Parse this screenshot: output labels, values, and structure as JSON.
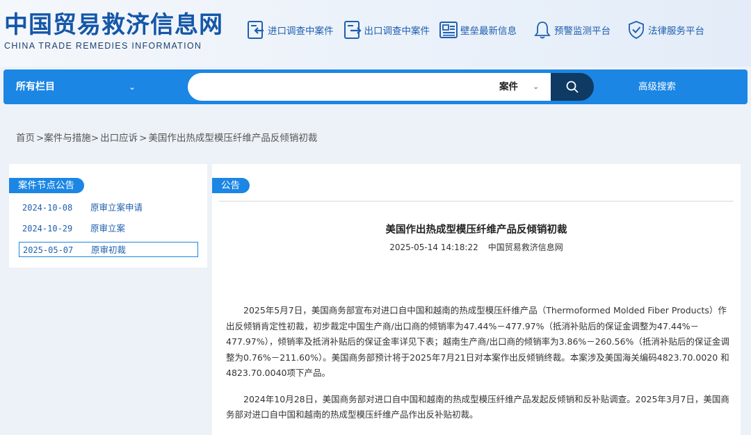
{
  "site": {
    "logo_cn": "中国贸易救济信息网",
    "logo_en": "CHINA TRADE REMEDIES INFORMATION"
  },
  "topnav": [
    {
      "label": "进口调查中案件",
      "icon": "import-case-icon"
    },
    {
      "label": "出口调查中案件",
      "icon": "export-case-icon"
    },
    {
      "label": "壁垒最新信息",
      "icon": "barrier-news-icon"
    },
    {
      "label": "预警监测平台",
      "icon": "bell-icon"
    },
    {
      "label": "法律服务平台",
      "icon": "shield-check-icon"
    }
  ],
  "searchbar": {
    "all_columns": "所有栏目",
    "query": "",
    "type": "案件",
    "advanced": "高级搜索"
  },
  "breadcrumb": [
    "首页",
    ">案件与措施>",
    "出口应诉",
    ">",
    "美国作出热成型模压纤维产品反倾销初裁"
  ],
  "left_panel": {
    "title": "案件节点公告",
    "nodes": [
      {
        "date": "2024-10-08",
        "name": "原审立案申请"
      },
      {
        "date": "2024-10-29",
        "name": "原审立案"
      },
      {
        "date": "2025-05-07",
        "name": "原审初裁"
      }
    ],
    "selected_index": 2
  },
  "main": {
    "tag": "公告",
    "title": "美国作出热成型模压纤维产品反倾销初裁",
    "datetime": "2025-05-14 14:18:22",
    "source": "中国贸易救济信息网",
    "paragraphs": [
      "2025年5月7日，美国商务部宣布对进口自中国和越南的热成型模压纤维产品（Thermoformed Molded Fiber Products）作出反倾销肯定性初裁，初步裁定中国生产商/出口商的倾销率为47.44%－477.97%（抵消补贴后的保证金调整为47.44%－477.97%），倾销率及抵消补贴后的保证金率详见下表；越南生产商/出口商的倾销率为3.86%－260.56%（抵消补贴后的保证金调整为0.76%－211.60%）。美国商务部预计将于2025年7月21日对本案作出反倾销终裁。本案涉及美国海关编码4823.70.0020 和4823.70.0040项下产品。",
      "2024年10月28日，美国商务部对进口自中国和越南的热成型模压纤维产品发起反倾销和反补贴调查。2025年3月7日，美国商务部对进口自中国和越南的热成型模压纤维产品作出反补贴初裁。"
    ]
  },
  "colors": {
    "brand_blue": "#1557a8",
    "accent_blue": "#1b86e4",
    "dark_navy": "#0f3a63",
    "page_bg": "#edf2f8"
  }
}
